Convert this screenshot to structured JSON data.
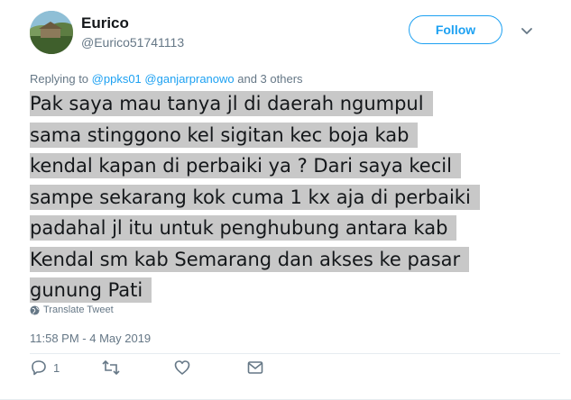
{
  "user": {
    "name": "Eurico",
    "handle": "@Eurico51741113"
  },
  "follow_label": "Follow",
  "replying": {
    "prefix": "Replying to",
    "mention1": "@ppks01",
    "mention2": "@ganjarpranowo",
    "suffix": "and 3 others"
  },
  "tweet": {
    "lines": [
      "Pak saya mau tanya jl di daerah ngumpul",
      "sama stinggono kel sigitan kec boja kab",
      "kendal kapan di perbaiki ya ? Dari saya kecil",
      "sampe sekarang kok cuma 1 kx aja di perbaiki",
      "padahal jl itu untuk penghubung antara kab",
      "Kendal sm kab Semarang dan akses ke pasar",
      "gunung Pati"
    ]
  },
  "translate_label": "Translate Tweet",
  "timestamp": "11:58 PM - 4 May 2019",
  "actions": {
    "reply_count": "1",
    "reply_icon": "reply-icon",
    "retweet_icon": "retweet-icon",
    "like_icon": "heart-icon",
    "dm_icon": "direct-message-icon"
  },
  "colors": {
    "accent": "#1da1f2",
    "muted": "#657786",
    "highlight": "#c8c8c8"
  }
}
